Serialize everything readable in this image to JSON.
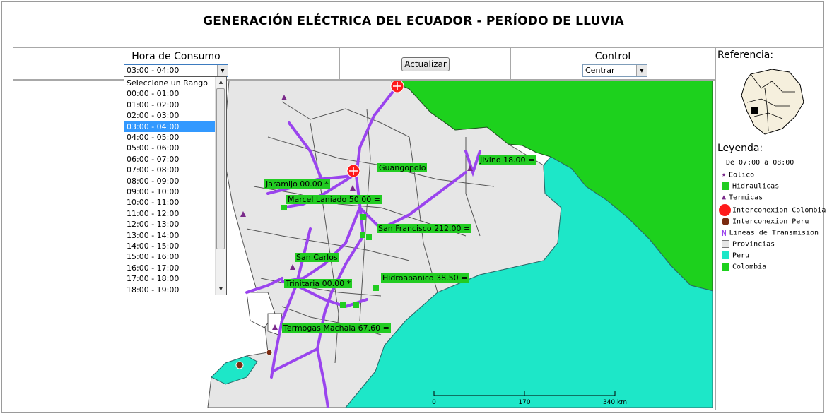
{
  "page": {
    "title": "GENERACIÓN ELÉCTRICA DEL ECUADOR - PERÍODO DE LLUVIA"
  },
  "controls": {
    "hora_label": "Hora de Consumo",
    "hora_value": "03:00 - 04:00",
    "update_button": "Actualizar",
    "control_label": "Control",
    "control_value": "Centrar"
  },
  "dropdown": {
    "options": [
      "Seleccione un Rango",
      "00:00 - 01:00",
      "01:00 - 02:00",
      "02:00 - 03:00",
      "03:00 - 04:00",
      "04:00 - 05:00",
      "05:00 - 06:00",
      "06:00 - 07:00",
      "07:00 - 08:00",
      "08:00 - 09:00",
      "09:00 - 10:00",
      "10:00 - 11:00",
      "11:00 - 12:00",
      "12:00 - 13:00",
      "13:00 - 14:00",
      "14:00 - 15:00",
      "15:00 - 16:00",
      "16:00 - 17:00",
      "17:00 - 18:00",
      "18:00 - 19:00"
    ],
    "selected_index": 4
  },
  "map": {
    "labels": [
      "Jivino 18.00 =",
      "Guangopolo",
      "Jaramijo 00.00 *",
      "Marcel Laniado 50.00 =",
      "San Francisco 212.00 =",
      "San Carlos",
      "Hidroabanico 38.50 =",
      "Trinitaria 00.00 *",
      "Termogas Machala 67.60 ="
    ],
    "scale": [
      "0",
      "170",
      "340 km"
    ]
  },
  "sidebar": {
    "referencia": "Referencia:",
    "leyenda": "Leyenda:",
    "period": "De 07:00 a 08:00",
    "items": [
      "Eolico",
      "Hidraulicas",
      "Termicas",
      "Interconexion Colombia",
      "Interconexion Peru",
      "Lineas de Transmision",
      "Provincias",
      "Peru",
      "Colombia"
    ]
  },
  "colors": {
    "hidro": "#22cc22",
    "termica": "#7a2a8a",
    "linea": "#9a44ee",
    "colombia": "#1dd11d",
    "peru": "#1de7c8",
    "provincia": "#e6e6e6",
    "selected": "#3399ff",
    "interconexion": "#ff1a1a"
  }
}
